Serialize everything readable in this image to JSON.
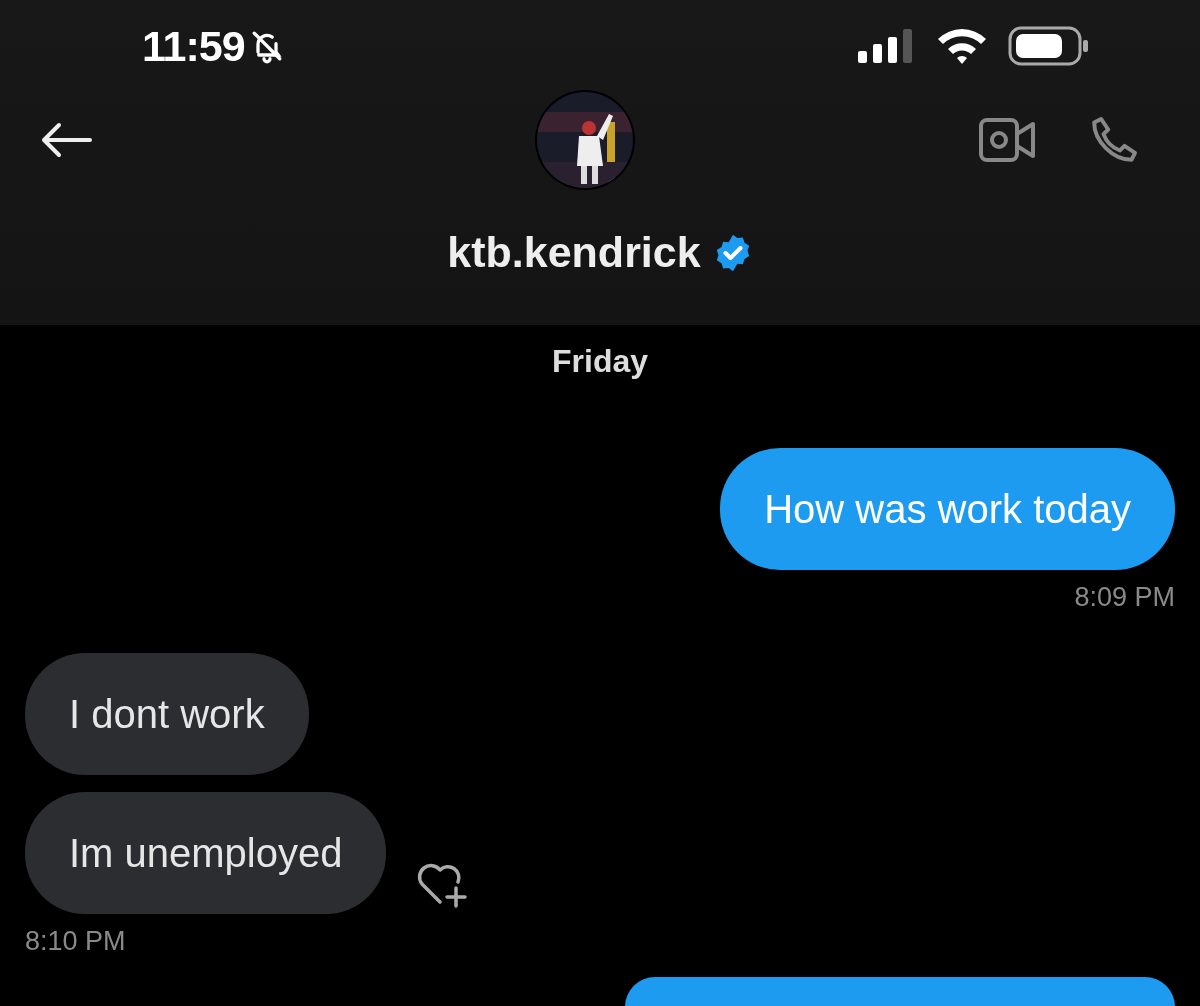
{
  "status_bar": {
    "time": "11:59",
    "silent": true
  },
  "header": {
    "username": "ktb.kendrick",
    "verified": true
  },
  "thread": [
    {
      "kind": "day",
      "text": "Friday"
    },
    {
      "kind": "bubble",
      "outgoing": true,
      "text": "How was work today"
    },
    {
      "kind": "time",
      "outgoing": true,
      "text": "8:09 PM"
    },
    {
      "kind": "bubble",
      "outgoing": false,
      "text": "I dont work"
    },
    {
      "kind": "bubble",
      "outgoing": false,
      "text": "Im unemployed",
      "react_button": true
    },
    {
      "kind": "time",
      "outgoing": false,
      "text": "8:10 PM"
    },
    {
      "kind": "bubble",
      "outgoing": true
    }
  ]
}
